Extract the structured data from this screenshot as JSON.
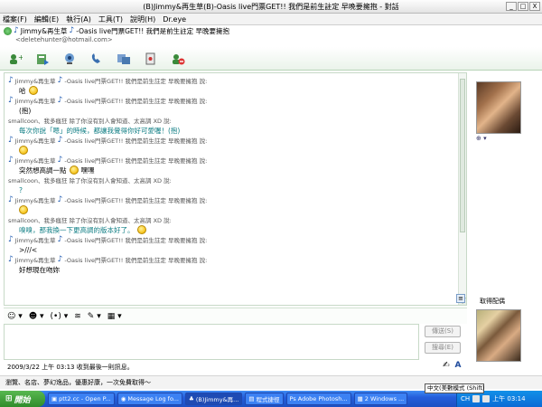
{
  "window": {
    "title": "(B)Jimmy&再生草(B)-Oasis live門票GET!! 我們是前生註定 早晚要擁抱 - 對話",
    "minimize": "_",
    "maximize": "□",
    "close": "X"
  },
  "menu": [
    "檔案(F)",
    "編輯(E)",
    "執行(A)",
    "工具(T)",
    "說明(H)",
    "Dr.eye"
  ],
  "contact": {
    "name": "Jimmy&再生草",
    "tagline": "-Oasis live門票GET!! 我們是前生註定 早晚要擁抱",
    "email": "<deletehunter@hotmail.com>"
  },
  "toolbar_icons": [
    "invite-icon",
    "send-files-icon",
    "webcam-icon",
    "call-icon",
    "activities-icon",
    "games-icon",
    "block-icon"
  ],
  "conversation": {
    "speaker_prefix": "Jimmy&再生草",
    "speaker_suffix": "-Oasis live門票GET!! 我們是前生註定 早晚要擁抱 說:",
    "me_speaker": "smallcoon、我多瘋狂 除了你沒有別人會知道、太高調 XD 說:",
    "messages": [
      {
        "from": "them",
        "text": "哈"
      },
      {
        "from": "them",
        "text": "(抱)"
      },
      {
        "from": "me",
        "text": "每次你說「嗯」的時候，都讓我覺得你好可愛喔！(抱)"
      },
      {
        "from": "them",
        "text": ""
      },
      {
        "from": "them",
        "text": "突然想高調一點",
        "suffix": "嘿嘿"
      },
      {
        "from": "me",
        "text": "?"
      },
      {
        "from": "them",
        "text": ""
      },
      {
        "from": "me",
        "text": "嗅嗅，那我換一下更高調的版本好了。"
      },
      {
        "from": "them",
        "text": ">///<"
      },
      {
        "from": "them",
        "text": "好想現在吻妳"
      }
    ]
  },
  "right_panel": {
    "avatar_label": "取得配偶",
    "menu_glyph": "⊕ ▾"
  },
  "format_bar": [
    "☺ ▾",
    "☻ ▾",
    "(•) ▾",
    "≋",
    "✎ ▾",
    "▦ ▾"
  ],
  "buttons": {
    "send": "傳送(S)",
    "search": "搜尋(E)"
  },
  "status_line": "2009/3/22 上午 03:13 收到最後一則訊息。",
  "ad_text": "瀏覽、名店、夢幻逸品，優惠好康，一次免費取得～",
  "ime": "中文(美數模式 (Shift)",
  "taskbar": {
    "start": "開始",
    "tasks": [
      {
        "label": "ptt2.cc - Open P...",
        "icon": "terminal-icon",
        "active": false
      },
      {
        "label": "Message Log fo...",
        "icon": "browser-icon",
        "active": false
      },
      {
        "label": "(B)Jimmy&再...",
        "icon": "messenger-icon",
        "active": true
      },
      {
        "label": "程式捷徑",
        "icon": "folder-icon",
        "active": false
      },
      {
        "label": "Adobe Photosh...",
        "icon": "photoshop-icon",
        "active": false
      },
      {
        "label": "2 Windows ...",
        "icon": "explorer-icon",
        "active": false
      }
    ],
    "clock": "上午 03:14",
    "lang": "CH"
  },
  "colors": {
    "accent_green": "#2a8a2a",
    "note_blue": "#1a57b0",
    "teal_text": "#0f7e84",
    "taskbar_blue": "#245edb"
  }
}
